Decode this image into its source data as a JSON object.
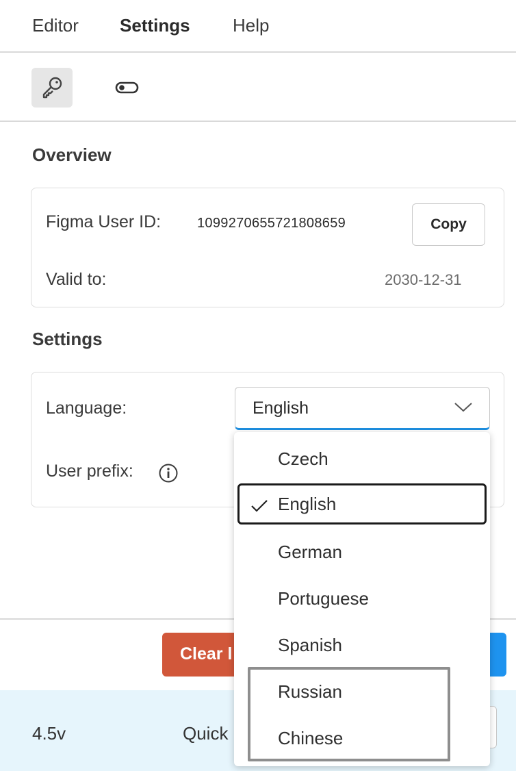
{
  "tabs": [
    {
      "label": "Editor"
    },
    {
      "label": "Settings"
    },
    {
      "label": "Help"
    }
  ],
  "icons": {
    "key": "key-icon",
    "toggle": "toggle-icon"
  },
  "overview": {
    "title": "Overview",
    "user_id_label": "Figma User ID:",
    "user_id_value": "1099270655721808659",
    "copy_label": "Copy",
    "valid_label": "Valid to:",
    "valid_value": "2030-12-31"
  },
  "settings": {
    "title": "Settings",
    "language_label": "Language:",
    "language_value": "English",
    "user_prefix_label": "User prefix:"
  },
  "dropdown": {
    "options": [
      "Czech",
      "English",
      "German",
      "Portuguese",
      "Spanish",
      "Russian",
      "Chinese"
    ],
    "selected": "English"
  },
  "footer": {
    "clear_label": "Clear l",
    "version": "4.5v",
    "quick_label": "Quick"
  },
  "colors": {
    "accent_blue": "#1e93ef",
    "clear_red": "#d1573a",
    "status_bar_bg": "#e6f5fc"
  }
}
